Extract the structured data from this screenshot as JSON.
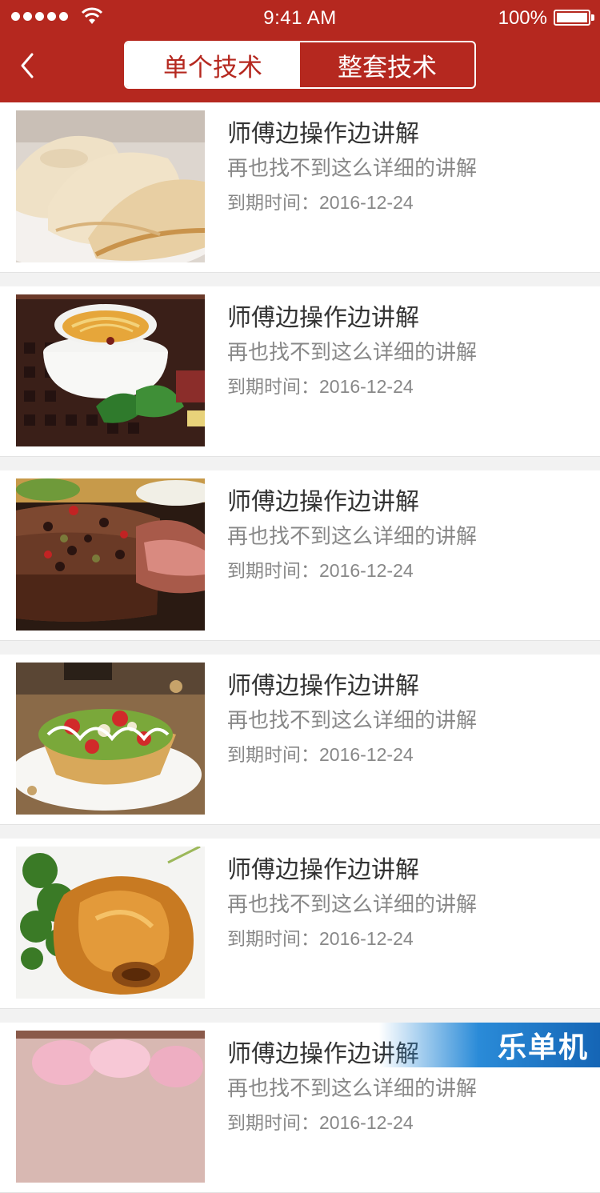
{
  "status_bar": {
    "time": "9:41 AM",
    "battery": "100%"
  },
  "nav": {
    "back_icon": "chevron-left-icon",
    "tabs": [
      {
        "label": "单个技术",
        "active": true
      },
      {
        "label": "整套技术",
        "active": false
      }
    ]
  },
  "items": [
    {
      "title": "师傅边操作边讲解",
      "desc": "再也找不到这么详细的讲解",
      "expire": "到期时间：2016-12-24",
      "image": "dumplings"
    },
    {
      "title": "师傅边操作边讲解",
      "desc": "再也找不到这么详细的讲解",
      "expire": "到期时间：2016-12-24",
      "image": "soup"
    },
    {
      "title": "师傅边操作边讲解",
      "desc": "再也找不到这么详细的讲解",
      "expire": "到期时间：2016-12-24",
      "image": "steak"
    },
    {
      "title": "师傅边操作边讲解",
      "desc": "再也找不到这么详细的讲解",
      "expire": "到期时间：2016-12-24",
      "image": "fruit-salad"
    },
    {
      "title": "师傅边操作边讲解",
      "desc": "再也找不到这么详细的讲解",
      "expire": "到期时间：2016-12-24",
      "image": "braised-trotter"
    },
    {
      "title": "师傅边操作边讲解",
      "desc": "再也找不到这么详细的讲解",
      "expire": "到期时间：2016-12-24",
      "image": "pink-dessert"
    }
  ],
  "watermark": "乐单机",
  "colors": {
    "brand": "#b5281f",
    "background": "#f2f2f2"
  }
}
